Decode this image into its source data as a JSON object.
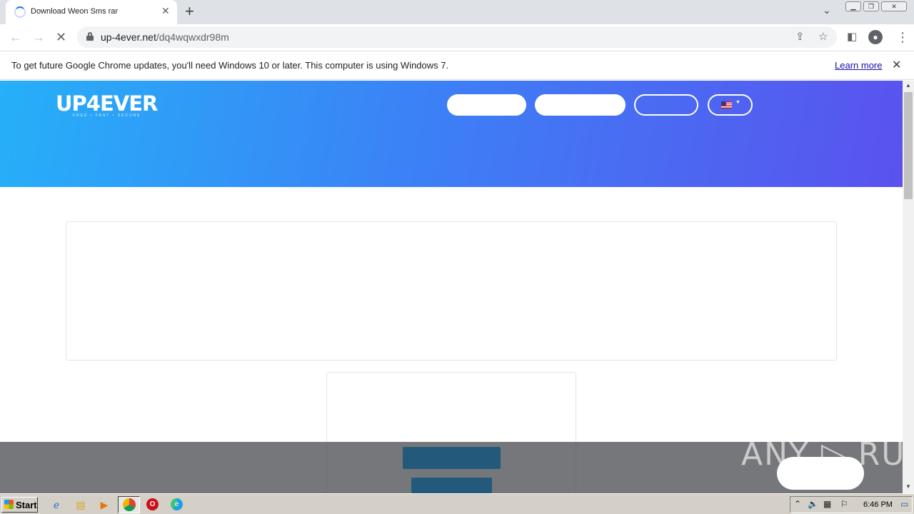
{
  "browser": {
    "tab_title": "Download Weon Sms rar",
    "tab_close": "✕",
    "new_tab": "+",
    "url_host": "up-4ever.net",
    "url_path": "/dq4wqwxdr98m"
  },
  "infobar": {
    "message": "To get future Google Chrome updates, you'll need Windows 10 or later. This computer is using Windows 7.",
    "learn_more": "Learn more",
    "close": "✕"
  },
  "site": {
    "logo": "UP4EVER",
    "logo_tagline": "FREE • FAST • SECURE"
  },
  "watermark": "ANY ▷ RUN",
  "taskbar": {
    "start": "Start",
    "clock": "6:46 PM"
  },
  "colors": {
    "hero_gradient_start": "#26b0f8",
    "hero_gradient_end": "#5a52ee",
    "download_button": "#235a7b",
    "link": "#1a0dab"
  }
}
